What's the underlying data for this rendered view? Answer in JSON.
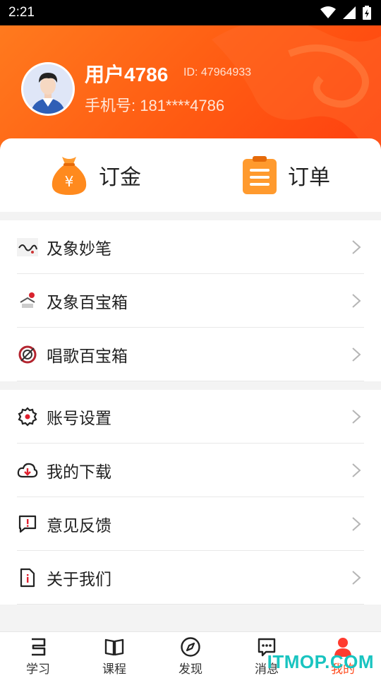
{
  "status_bar": {
    "time": "2:21"
  },
  "profile": {
    "username": "用户4786",
    "id_text": "ID: 47964933",
    "phone_text": "手机号: 181****4786"
  },
  "quick_actions": [
    {
      "label": "订金",
      "icon": "money-bag-icon"
    },
    {
      "label": "订单",
      "icon": "clipboard-icon"
    }
  ],
  "menu_group_1": [
    {
      "label": "及象妙笔",
      "icon": "calligraphy-thumbnail"
    },
    {
      "label": "及象百宝箱",
      "icon": "treasure-box-thumbnail"
    },
    {
      "label": "唱歌百宝箱",
      "icon": "singing-box-thumbnail"
    }
  ],
  "menu_group_2": [
    {
      "label": "账号设置",
      "icon": "gear-icon"
    },
    {
      "label": "我的下载",
      "icon": "cloud-download-icon"
    },
    {
      "label": "意见反馈",
      "icon": "feedback-icon"
    },
    {
      "label": "关于我们",
      "icon": "info-doc-icon"
    }
  ],
  "tabbar": [
    {
      "label": "学习",
      "icon": "study-icon"
    },
    {
      "label": "课程",
      "icon": "book-icon"
    },
    {
      "label": "发现",
      "icon": "compass-icon"
    },
    {
      "label": "消息",
      "icon": "message-icon"
    },
    {
      "label": "我的",
      "icon": "person-icon",
      "active": true
    }
  ],
  "watermark": "ITMOP.COM",
  "colors": {
    "accent": "#ff5a12",
    "active_tab": "#ff4a1c",
    "watermark": "#19c4c0"
  }
}
